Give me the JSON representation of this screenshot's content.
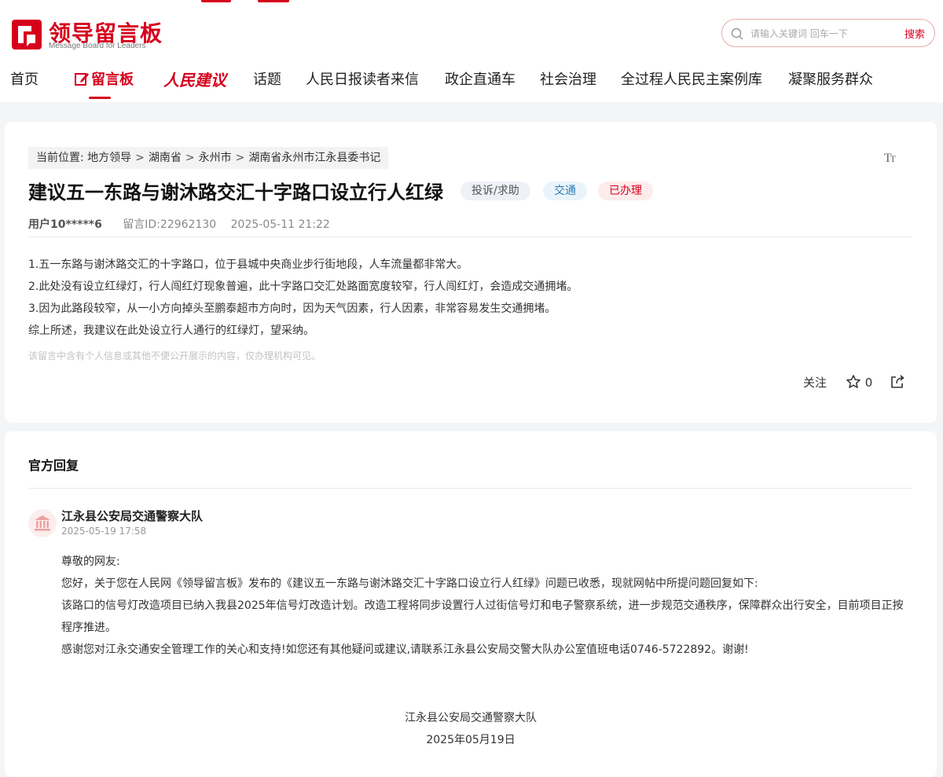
{
  "header": {
    "logo_title": "领导留言板",
    "logo_subtitle": "Message Board for Leaders",
    "search_placeholder": "请输入关键词 回车一下",
    "search_button": "搜索"
  },
  "nav": {
    "items": [
      "首页",
      "留言板",
      "人民建议",
      "话题",
      "人民日报读者来信",
      "政企直通车",
      "社会治理",
      "全过程人民民主案例库",
      "凝聚服务群众"
    ]
  },
  "breadcrumb": {
    "prefix": "当前位置:",
    "items": [
      "地方领导",
      "湖南省",
      "永州市",
      "湖南省永州市江永县委书记"
    ]
  },
  "message": {
    "title": "建议五一东路与谢沐路交汇十字路口设立行人红绿",
    "tags": [
      "投诉/求助",
      "交通",
      "已办理"
    ],
    "user": "用户10*****6",
    "message_id": "留言ID:22962130",
    "time": "2025-05-11 21:22",
    "content": [
      "1.五一东路与谢沐路交汇的十字路口，位于县城中央商业步行街地段，人车流量都非常大。",
      "2.此处没有设立红绿灯，行人闯红灯现象普遍，此十字路口交汇处路面宽度较窄，行人闯红灯，会造成交通拥堵。",
      "3.因为此路段较窄，从一小方向掉头至鹏泰超市方向时，因为天气因素，行人因素，非常容易发生交通拥堵。",
      "综上所述，我建议在此处设立行人通行的红绿灯，望采纳。"
    ],
    "privacy_notice": "该留言中含有个人信息或其他不便公开展示的内容，仅办理机构可见。",
    "follow_label": "关注",
    "star_count": "0"
  },
  "reply": {
    "heading": "官方回复",
    "org_name": "江永县公安局交通警察大队",
    "time": "2025-05-19 17:58",
    "paragraphs": [
      "尊敬的网友:",
      "您好，关于您在人民网《领导留言板》发布的《建议五一东路与谢沐路交汇十字路口设立行人红绿》问题已收悉，现就网帖中所提问题回复如下:",
      "该路口的信号灯改造项目已纳入我县2025年信号灯改造计划。改造工程将同步设置行人过街信号灯和电子警察系统，进一步规范交通秩序，保障群众出行安全，目前项目正按程序推进。",
      "感谢您对江永交通安全管理工作的关心和支持!如您还有其他疑问或建议,请联系江永县公安局交警大队办公室值班电话0746-5722892。谢谢!"
    ],
    "signature_org": "江永县公安局交通警察大队",
    "signature_date": "2025年05月19日"
  },
  "colors": {
    "brand_red": "#d6001c",
    "field_blue": "#2c7fb8"
  },
  "icons": {
    "search": "search-icon",
    "font_size": "font-size-icon",
    "star": "star-icon",
    "share": "share-icon",
    "org": "government-building-icon"
  }
}
